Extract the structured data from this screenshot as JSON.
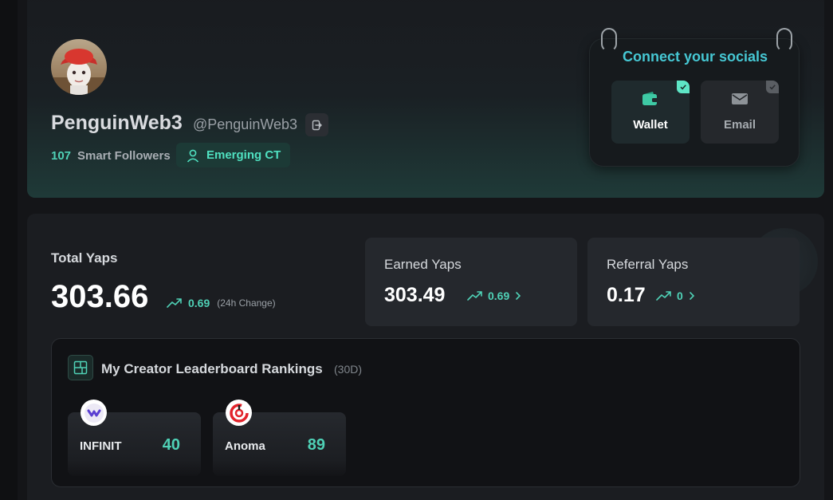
{
  "profile": {
    "name": "PenguinWeb3",
    "handle": "@PenguinWeb3",
    "smart_followers_count": "107",
    "smart_followers_label": "Smart Followers",
    "badge": "Emerging CT"
  },
  "socials": {
    "title": "Connect your socials",
    "wallet_label": "Wallet",
    "email_label": "Email"
  },
  "yaps": {
    "total_label": "Total Yaps",
    "total_value": "303.66",
    "total_change": "0.69",
    "total_change_note": "(24h Change)",
    "earned_label": "Earned Yaps",
    "earned_value": "303.49",
    "earned_change": "0.69",
    "referral_label": "Referral Yaps",
    "referral_value": "0.17",
    "referral_change": "0"
  },
  "leaderboard": {
    "title": "My Creator Leaderboard Rankings",
    "period": "(30D)",
    "rankings": [
      {
        "name": "INFINIT",
        "score": "40"
      },
      {
        "name": "Anoma",
        "score": "89"
      }
    ]
  },
  "colors": {
    "accent": "#4fd1b6",
    "socials_title": "#46c8d4",
    "background": "#141518"
  }
}
